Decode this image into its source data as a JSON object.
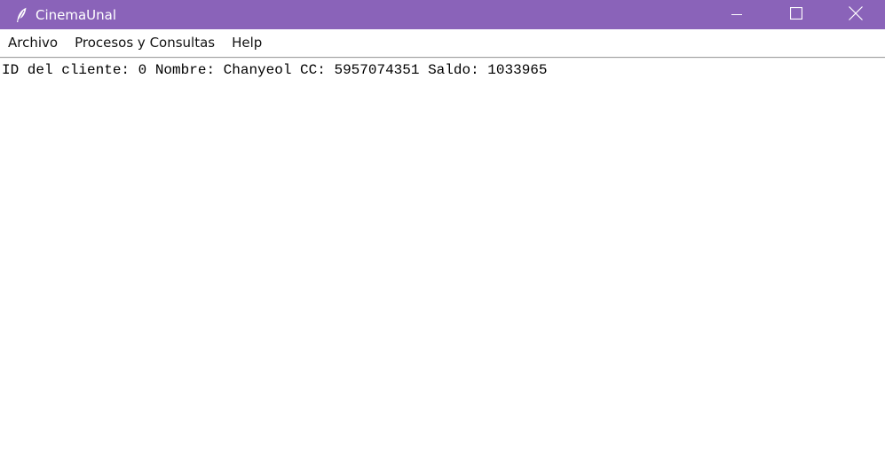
{
  "window": {
    "title": "CinemaUnal",
    "title_icon": "feather-icon",
    "controls": {
      "minimize_icon": "minimize-icon",
      "maximize_icon": "maximize-icon",
      "close_icon": "close-icon"
    }
  },
  "menubar": {
    "items": [
      {
        "label": "Archivo"
      },
      {
        "label": "Procesos y Consultas"
      },
      {
        "label": "Help"
      }
    ]
  },
  "content": {
    "line": "ID del cliente: 0 Nombre: Chanyeol CC: 5957074351 Saldo: 1033965"
  },
  "colors": {
    "titlebar_bg": "#8a63b9",
    "titlebar_text": "#ffffff",
    "menubar_bg": "#ffffff",
    "content_bg": "#ffffff",
    "text": "#000000"
  }
}
